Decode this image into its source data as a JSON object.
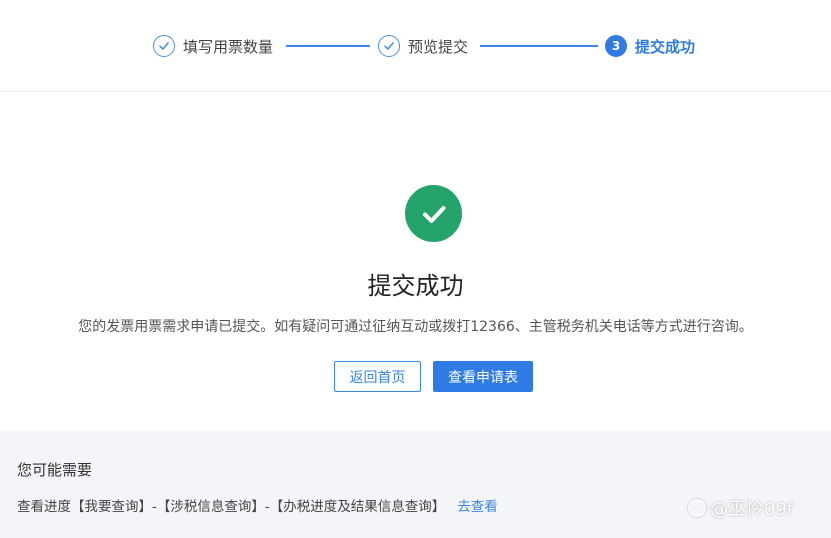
{
  "stepper": {
    "steps": [
      {
        "label": "填写用票数量",
        "state": "done"
      },
      {
        "label": "预览提交",
        "state": "done"
      },
      {
        "label": "提交成功",
        "state": "current",
        "number": "3"
      }
    ]
  },
  "result": {
    "title": "提交成功",
    "description": "您的发票用票需求申请已提交。如有疑问可通过征纳互动或拨打12366、主管税务机关电话等方式进行咨询。",
    "buttons": {
      "home": "返回首页",
      "view": "查看申请表"
    }
  },
  "needs": {
    "title": "您可能需要",
    "row_text": "查看进度【我要查询】-【涉税信息查询】-【办税进度及结果信息查询】",
    "link": "去查看"
  },
  "watermark": {
    "text": "@巫怜09f"
  },
  "colors": {
    "primary": "#2f7be5",
    "success": "#24a36b",
    "panel_bg": "#f3f5f8"
  }
}
